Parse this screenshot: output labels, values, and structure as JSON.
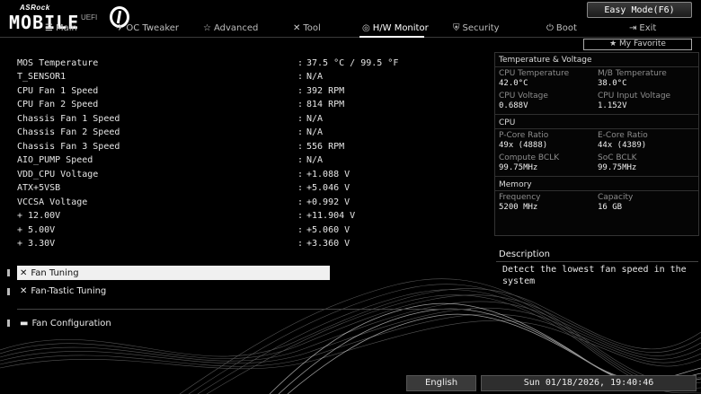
{
  "header": {
    "brand": "ASRock",
    "product": "MOBILE",
    "version": "UEFI",
    "easy_mode": "Easy Mode(F6)",
    "favorite": "My Favorite"
  },
  "tabs": [
    {
      "label": "Main",
      "icon": "list-icon",
      "active": false
    },
    {
      "label": "OC Tweaker",
      "icon": "rocket-icon",
      "active": false
    },
    {
      "label": "Advanced",
      "icon": "star-icon",
      "active": false
    },
    {
      "label": "Tool",
      "icon": "tools-icon",
      "active": false
    },
    {
      "label": "H/W Monitor",
      "icon": "monitor-icon",
      "active": true
    },
    {
      "label": "Security",
      "icon": "shield-icon",
      "active": false
    },
    {
      "label": "Boot",
      "icon": "power-icon",
      "active": false
    },
    {
      "label": "Exit",
      "icon": "exit-icon",
      "active": false
    }
  ],
  "readings": [
    {
      "label": "MOS Temperature",
      "value": "37.5 °C /  99.5 °F"
    },
    {
      "label": "T_SENSOR1",
      "value": "N/A"
    },
    {
      "label": "CPU Fan 1 Speed",
      "value": "392 RPM"
    },
    {
      "label": "CPU Fan 2 Speed",
      "value": "814 RPM"
    },
    {
      "label": "Chassis Fan 1 Speed",
      "value": "N/A"
    },
    {
      "label": "Chassis Fan 2 Speed",
      "value": "N/A"
    },
    {
      "label": "Chassis Fan 3 Speed",
      "value": "556 RPM"
    },
    {
      "label": "AIO_PUMP Speed",
      "value": "N/A"
    },
    {
      "label": "VDD_CPU Voltage",
      "value": "+1.088 V"
    },
    {
      "label": "ATX+5VSB",
      "value": "+5.046 V"
    },
    {
      "label": "VCCSA Voltage",
      "value": "+0.992 V"
    },
    {
      "label": "+ 12.00V",
      "value": "+11.904 V"
    },
    {
      "label": "+ 5.00V",
      "value": "+5.060 V"
    },
    {
      "label": "+ 3.30V",
      "value": "+3.360 V"
    }
  ],
  "colon": ":",
  "menu": {
    "fan_tuning": "Fan Tuning",
    "fan_tastic": "Fan-Tastic Tuning",
    "fan_config": "Fan Configuration"
  },
  "panel": {
    "temp_title": "Temperature & Voltage",
    "cpu_temp_label": "CPU Temperature",
    "cpu_temp": "42.0°C",
    "mb_temp_label": "M/B Temperature",
    "mb_temp": "38.0°C",
    "cpu_volt_label": "CPU Voltage",
    "cpu_volt": "0.688V",
    "cpu_in_label": "CPU Input Voltage",
    "cpu_in": "1.152V",
    "cpu_title": "CPU",
    "pcore_label": "P-Core Ratio",
    "pcore": "49x (4888)",
    "ecore_label": "E-Core Ratio",
    "ecore": "44x (4389)",
    "cbclk_label": "Compute BCLK",
    "cbclk": "99.75MHz",
    "socbclk_label": "SoC BCLK",
    "socbclk": "99.75MHz",
    "mem_title": "Memory",
    "freq_label": "Frequency",
    "freq": "5200 MHz",
    "cap_label": "Capacity",
    "cap": "16 GB"
  },
  "description": {
    "title": "Description",
    "text": "Detect the lowest fan speed in the system"
  },
  "footer": {
    "language": "English",
    "datetime": "Sun 01/18/2026, 19:40:46"
  }
}
